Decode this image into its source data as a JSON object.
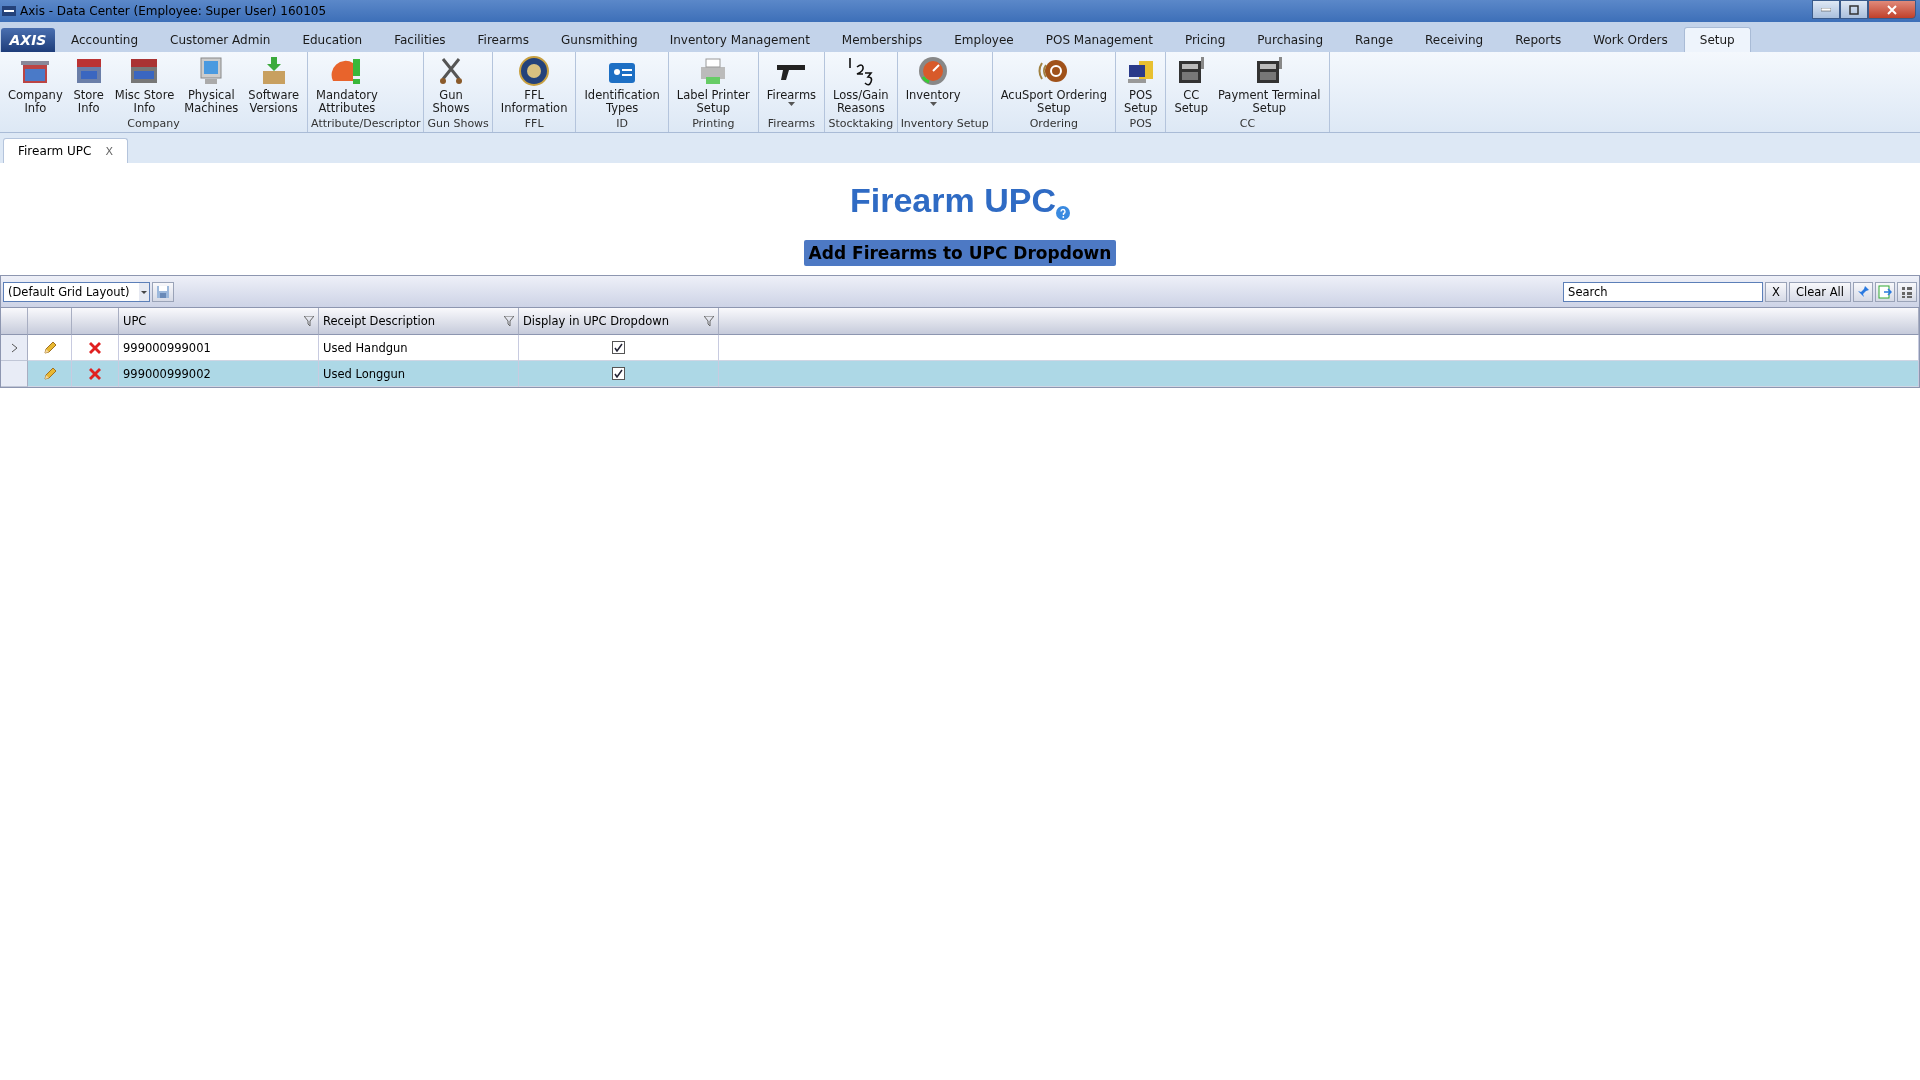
{
  "window": {
    "title": "Axis - Data Center  (Employee: Super User) 160105"
  },
  "menu": {
    "logo": "AXIS",
    "tabs": [
      {
        "label": "Accounting",
        "selected": false
      },
      {
        "label": "Customer Admin",
        "selected": false
      },
      {
        "label": "Education",
        "selected": false
      },
      {
        "label": "Facilities",
        "selected": false
      },
      {
        "label": "Firearms",
        "selected": false
      },
      {
        "label": "Gunsmithing",
        "selected": false
      },
      {
        "label": "Inventory Management",
        "selected": false
      },
      {
        "label": "Memberships",
        "selected": false
      },
      {
        "label": "Employee",
        "selected": false
      },
      {
        "label": "POS Management",
        "selected": false
      },
      {
        "label": "Pricing",
        "selected": false
      },
      {
        "label": "Purchasing",
        "selected": false
      },
      {
        "label": "Range",
        "selected": false
      },
      {
        "label": "Receiving",
        "selected": false
      },
      {
        "label": "Reports",
        "selected": false
      },
      {
        "label": "Work Orders",
        "selected": false
      },
      {
        "label": "Setup",
        "selected": true
      }
    ]
  },
  "ribbon": {
    "groups": [
      {
        "label": "Company",
        "items": [
          {
            "label": "Company\nInfo",
            "dropdown": false
          },
          {
            "label": "Store\nInfo",
            "dropdown": false
          },
          {
            "label": "Misc Store\nInfo",
            "dropdown": false
          },
          {
            "label": "Physical\nMachines",
            "dropdown": false
          },
          {
            "label": "Software\nVersions",
            "dropdown": false
          }
        ]
      },
      {
        "label": "Attribute/Descriptor",
        "items": [
          {
            "label": "Mandatory\nAttributes",
            "dropdown": false
          }
        ]
      },
      {
        "label": "Gun Shows",
        "items": [
          {
            "label": "Gun\nShows",
            "dropdown": false
          }
        ]
      },
      {
        "label": "FFL",
        "items": [
          {
            "label": "FFL\nInformation",
            "dropdown": false
          }
        ]
      },
      {
        "label": "ID",
        "items": [
          {
            "label": "Identification\nTypes",
            "dropdown": false
          }
        ]
      },
      {
        "label": "Printing",
        "items": [
          {
            "label": "Label Printer\nSetup",
            "dropdown": false
          }
        ]
      },
      {
        "label": "Firearms",
        "items": [
          {
            "label": "Firearms",
            "dropdown": true
          }
        ]
      },
      {
        "label": "Stocktaking",
        "items": [
          {
            "label": "Loss/Gain\nReasons",
            "dropdown": false
          }
        ]
      },
      {
        "label": "Inventory Setup",
        "items": [
          {
            "label": "Inventory",
            "dropdown": true
          }
        ]
      },
      {
        "label": "Ordering",
        "items": [
          {
            "label": "AcuSport Ordering\nSetup",
            "dropdown": false
          }
        ]
      },
      {
        "label": "POS",
        "items": [
          {
            "label": "POS\nSetup",
            "dropdown": false
          }
        ]
      },
      {
        "label": "CC",
        "items": [
          {
            "label": "CC\nSetup",
            "dropdown": false
          },
          {
            "label": "Payment Terminal\nSetup",
            "dropdown": false
          }
        ]
      }
    ]
  },
  "doc_tabs": [
    {
      "label": "Firearm UPC",
      "close": "X",
      "selected": true
    }
  ],
  "page": {
    "title": "Firearm UPC",
    "action_button": "Add Firearms to UPC Dropdown"
  },
  "grid_toolbar": {
    "layout": "(Default Grid Layout)",
    "search": {
      "value": "Search"
    },
    "clear_search": "X",
    "clear_all": "Clear All"
  },
  "table": {
    "columns": [
      "UPC",
      "Receipt Description",
      "Display in UPC Dropdown"
    ],
    "rows": [
      {
        "current": true,
        "selected": false,
        "upc": "999000999001",
        "description": "Used Handgun",
        "display": true
      },
      {
        "current": false,
        "selected": true,
        "upc": "999000999002",
        "description": "Used Longgun",
        "display": true
      }
    ]
  }
}
